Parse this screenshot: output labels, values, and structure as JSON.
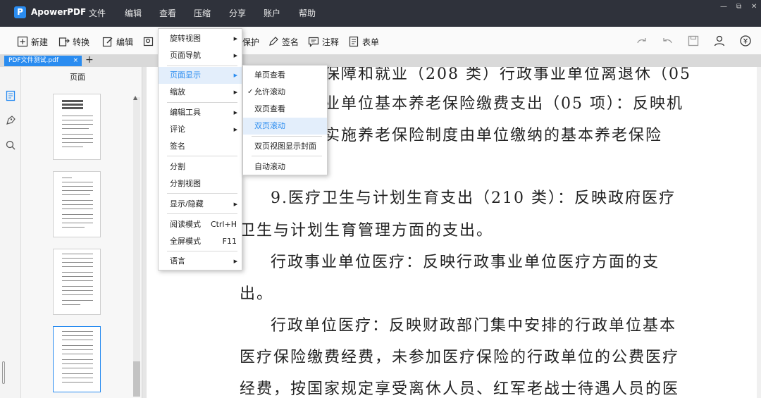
{
  "app": {
    "logo_letter": "P",
    "name": "ApowerPDF"
  },
  "menubar": [
    "文件",
    "编辑",
    "查看",
    "压缩",
    "分享",
    "账户",
    "帮助"
  ],
  "window_controls": {
    "minimize": "—",
    "restore": "⧉",
    "close": "✕"
  },
  "toolbar": {
    "new": "新建",
    "convert": "转换",
    "edit": "编辑",
    "protect": "保护",
    "sign": "签名",
    "comment": "注释",
    "form": "表单"
  },
  "tab": {
    "label": "PDF文件测试.pdf",
    "close": "×",
    "add": "+"
  },
  "panel": {
    "title": "页面"
  },
  "view_menu": {
    "items": [
      {
        "label": "旋转视图",
        "submenu": true
      },
      {
        "label": "页面导航",
        "submenu": true
      },
      {
        "label": "页面显示",
        "submenu": true,
        "active": true
      },
      {
        "label": "缩放",
        "submenu": true
      },
      {
        "label": "编辑工具",
        "submenu": true
      },
      {
        "label": "评论",
        "submenu": true
      },
      {
        "label": "签名",
        "submenu": false
      },
      {
        "label": "分割",
        "submenu": false
      },
      {
        "label": "分割视图",
        "submenu": false
      },
      {
        "label": "显示/隐藏",
        "submenu": true
      },
      {
        "label": "阅读模式",
        "shortcut": "Ctrl+H"
      },
      {
        "label": "全屏模式",
        "shortcut": "F11"
      },
      {
        "label": "语言",
        "submenu": true
      }
    ]
  },
  "page_display_submenu": {
    "items": [
      {
        "label": "单页查看",
        "checked": false
      },
      {
        "label": "允许滚动",
        "checked": true
      },
      {
        "label": "双页查看",
        "checked": false
      },
      {
        "label": "双页滚动",
        "checked": false,
        "hover": true
      },
      {
        "label": "双页视图显示封面",
        "checked": false
      },
      {
        "label": "自动滚动",
        "checked": false
      }
    ]
  },
  "document": {
    "lines": [
      "保障和就业（208 类）行政事业单位离退休（05",
      "业单位基本养老保险缴费支出（05 项）：反映机",
      "实施养老保险制度由单位缴纳的基本养老保险",
      "9.医疗卫生与计划生育支出（210 类）：反映政府医疗",
      "卫生与计划生育管理方面的支出。",
      "行政事业单位医疗：反映行政事业单位医疗方面的支",
      "出。",
      "行政单位医疗：反映财政部门集中安排的行政单位基本",
      "医疗保险缴费经费，未参加医疗保险的行政单位的公费医疗",
      "经费，按国家规定享受离休人员、红军老战士待遇人员的医"
    ]
  },
  "colors": {
    "titlebar": "#2f323b",
    "accent": "#2a8cf0",
    "highlight": "#e3eefb"
  }
}
